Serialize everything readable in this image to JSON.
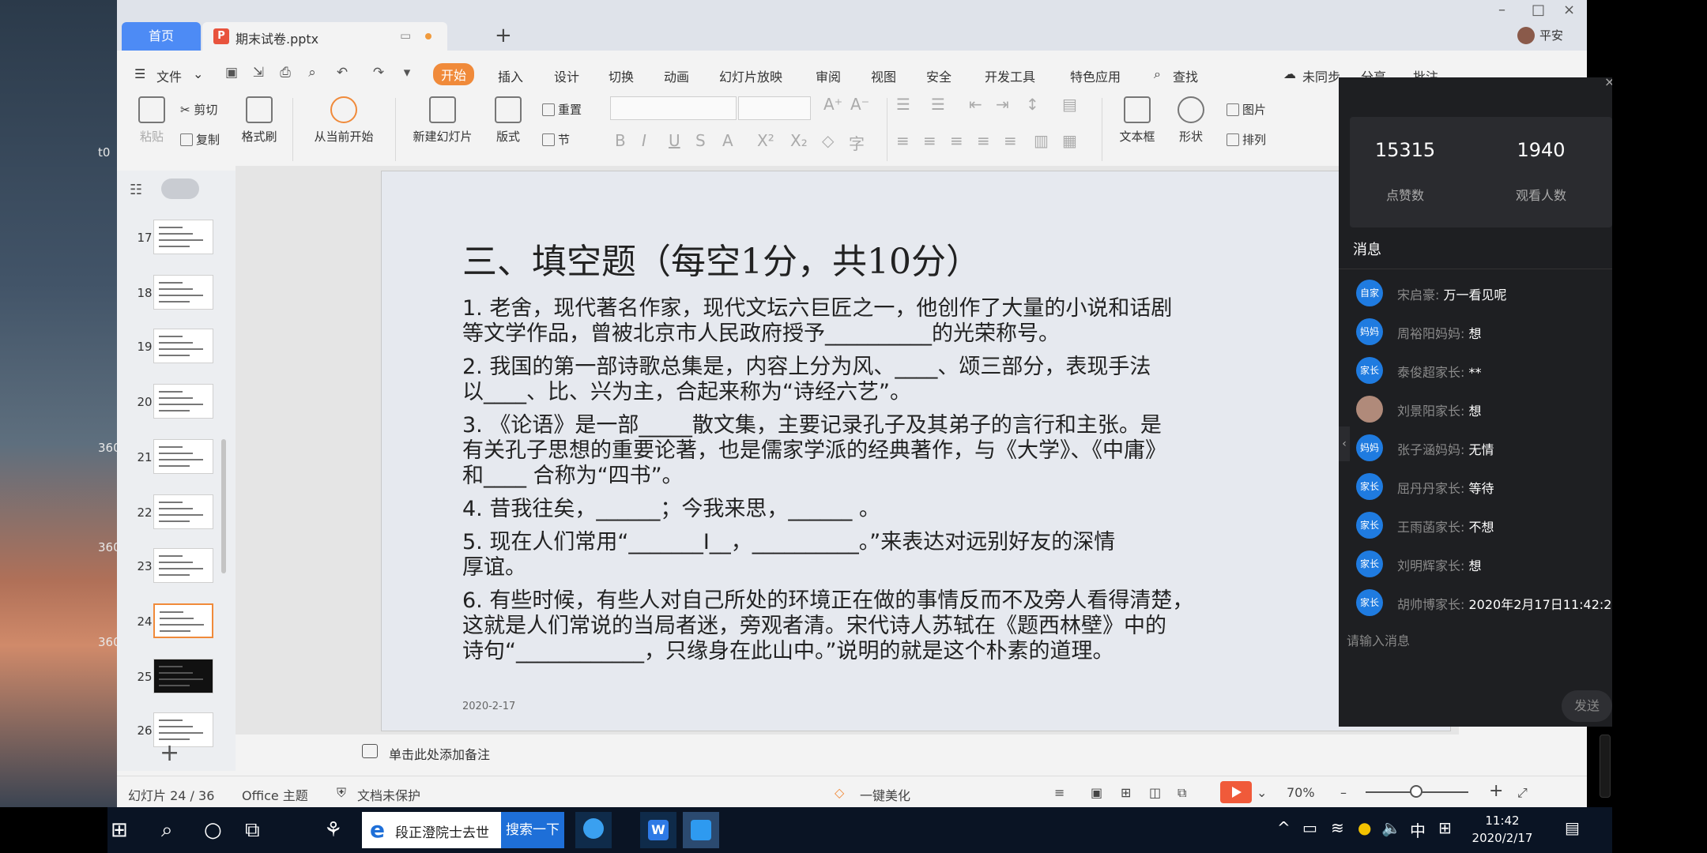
{
  "tabs": {
    "home": "首页",
    "doc": "期末试卷.pptx",
    "add": "+"
  },
  "user": {
    "name": "平安"
  },
  "menu": {
    "file": "文件",
    "items": [
      "开始",
      "插入",
      "设计",
      "切换",
      "动画",
      "幻灯片放映",
      "审阅",
      "视图",
      "安全",
      "开发工具",
      "特色应用"
    ],
    "search": "查找",
    "sync": "未同步",
    "share": "分享",
    "comment": "批注"
  },
  "ribbon": {
    "paste": "粘贴",
    "cut": "剪切",
    "copy": "复制",
    "format_painter": "格式刷",
    "play_from_current": "从当前开始",
    "new_slide": "新建幻灯片",
    "layout": "版式",
    "reset": "重置",
    "section": "节",
    "textbox": "文本框",
    "shape": "形状",
    "picture": "图片",
    "arrange": "排列"
  },
  "thumbnails": [
    "17",
    "18",
    "19",
    "20",
    "21",
    "22",
    "23",
    "24",
    "25",
    "26"
  ],
  "selected_slide": "24",
  "slide": {
    "title": "三、填空题（每空1分，共10分）",
    "lines": [
      "1. 老舍，现代著名作家，现代文坛六巨匠之一，他创作了大量的小说和话剧",
      "等文学作品，曾被北京市人民政府授予__________的光荣称号。",
      "2. 我国的第一部诗歌总集是，内容上分为风、____、颂三部分，表现手法",
      "以____、比、兴为主，合起来称为“诗经六艺”。",
      "3. 《论语》是一部_____散文集，主要记录孔子及其弟子的言行和主张。是",
      "有关孔子思想的重要论著，也是儒家学派的经典著作，与《大学》、《中庸》",
      "和____ 合称为“四书”。",
      "4. 昔我往矣，______；今我来思，______ 。",
      "5. 现在人们常用“_______I__，__________。”来表达对远别好友的深情",
      "厚谊。",
      "6. 有些时候，有些人对自己所处的环境正在做的事情反而不及旁人看得清楚，",
      "这就是人们常说的当局者迷，旁观者清。宋代诗人苏轼在《题西林壁》中的",
      "诗句“____________，只缘身在此山中。”说明的就是这个朴素的道理。"
    ],
    "date": "2020-2-17"
  },
  "notes": {
    "placeholder": "单击此处添加备注"
  },
  "status": {
    "slide_count": "幻灯片 24 / 36",
    "theme": "Office 主题",
    "protect": "文档未保护",
    "beautify": "一键美化",
    "zoom": "70%"
  },
  "live": {
    "likes": "15315",
    "likes_label": "点赞数",
    "viewers": "1940",
    "viewers_label": "观看人数",
    "messages_title": "消息",
    "messages": [
      {
        "avatar": "自家",
        "name": "宋启豪:",
        "text": "万一看见呢"
      },
      {
        "avatar": "妈妈",
        "name": "周裕阳妈妈:",
        "text": "想"
      },
      {
        "avatar": "家长",
        "name": "泰俊超家长:",
        "text": "**"
      },
      {
        "avatar": "",
        "name": "刘景阳家长:",
        "text": "想"
      },
      {
        "avatar": "妈妈",
        "name": "张子涵妈妈:",
        "text": "无情"
      },
      {
        "avatar": "家长",
        "name": "屈丹丹家长:",
        "text": "等待"
      },
      {
        "avatar": "家长",
        "name": "王雨菡家长:",
        "text": "不想"
      },
      {
        "avatar": "家长",
        "name": "刘明辉家长:",
        "text": "想"
      },
      {
        "avatar": "家长",
        "name": "胡帅博家长:",
        "text": "2020年2月17日11:42:2"
      }
    ],
    "input_placeholder": "请输入消息",
    "send": "发送"
  },
  "taskbar": {
    "browser_title": "段正澄院士去世",
    "search_btn": "搜索一下",
    "ime": "中",
    "time": "11:42",
    "date": "2020/2/17"
  },
  "desktop_labels": [
    "t0",
    "360",
    "360",
    "360"
  ],
  "colors": {
    "accent": "#f08a3a",
    "tab_home": "#4d8bf5",
    "live_bg": "#1e1f22",
    "avatar": "#1f7be0"
  }
}
